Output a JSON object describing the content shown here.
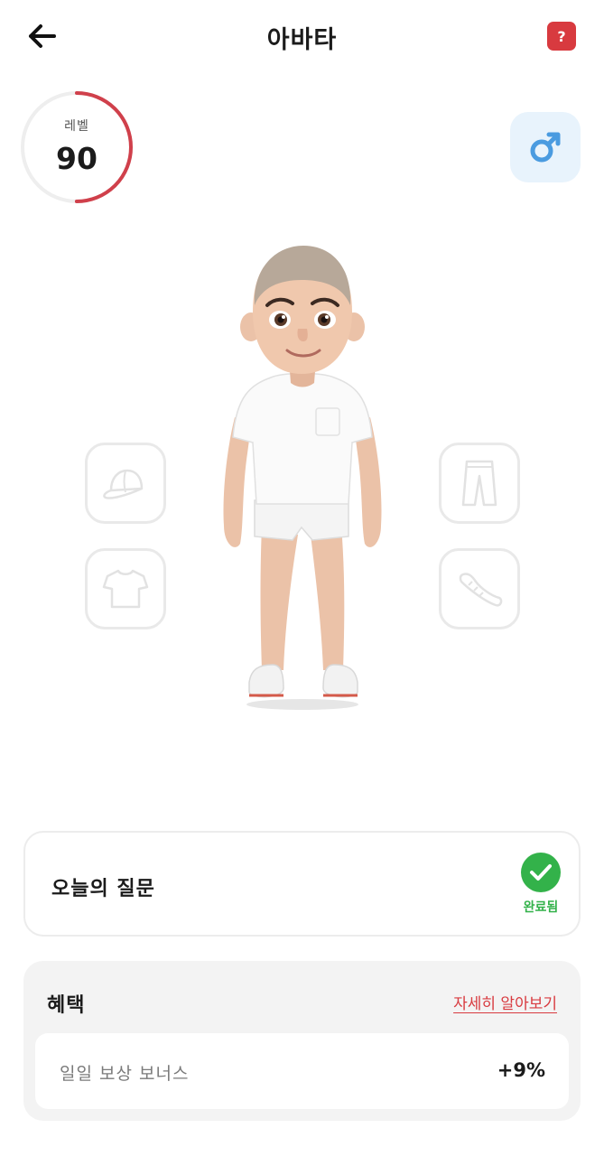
{
  "header": {
    "title": "아바타",
    "back_icon": "arrow-left-icon",
    "help_label": "?"
  },
  "level": {
    "label": "레벨",
    "value": "90",
    "progress": 0.5,
    "ring_color": "#d0404b"
  },
  "gender": {
    "icon": "male-symbol-icon",
    "color": "#4a9be0"
  },
  "slots": [
    {
      "name": "hat",
      "icon": "cap-icon"
    },
    {
      "name": "shirt",
      "icon": "t-shirt-icon"
    },
    {
      "name": "pants",
      "icon": "pants-icon"
    },
    {
      "name": "shoes",
      "icon": "sneaker-icon"
    }
  ],
  "question": {
    "title": "오늘의 질문",
    "status": "완료됨",
    "status_color": "#33b24a"
  },
  "benefit": {
    "title": "혜택",
    "link": "자세히 알아보기",
    "row_label": "일일 보상 보너스",
    "row_value": "+9%"
  }
}
